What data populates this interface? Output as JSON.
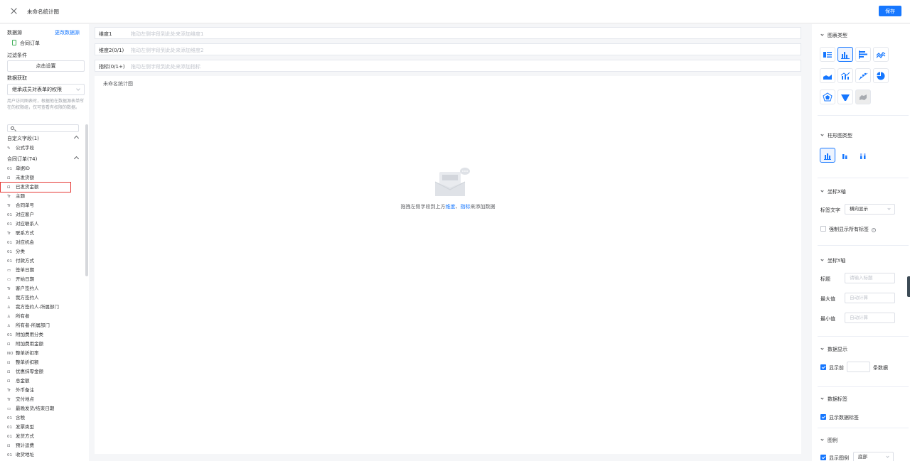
{
  "header": {
    "title": "未命名统计图",
    "save_label": "保存"
  },
  "left": {
    "datasource_label": "数据源",
    "change_link": "更改数据源",
    "datasource_name": "合同订单",
    "filter_label": "过滤条件",
    "filter_button": "点击设置",
    "fetch_label": "数据获取",
    "fetch_select": "继承成员对表单的权限",
    "fetch_hint": "用户访问图表时，根据他在数据源表单所在的权限组，仅可查看有权限的数据。",
    "custom_group": "自定义字段(1)",
    "formula_field": "公式字段",
    "orders_group": "合同订单(74)",
    "fields": [
      {
        "t": "01",
        "label": "单据ID"
      },
      {
        "t": "#",
        "label": "未发货额"
      },
      {
        "t": "#",
        "label": "已发货金额"
      },
      {
        "t": "Tr",
        "label": "主题"
      },
      {
        "t": "Tr",
        "label": "合同单号"
      },
      {
        "t": "01",
        "label": "对应客户"
      },
      {
        "t": "01",
        "label": "对应联系人"
      },
      {
        "t": "Tr",
        "label": "联系方式"
      },
      {
        "t": "01",
        "label": "对应机会"
      },
      {
        "t": "01",
        "label": "分类"
      },
      {
        "t": "01",
        "label": "付款方式"
      },
      {
        "t": "cal",
        "label": "签单日期"
      },
      {
        "t": "cal",
        "label": "开始日期"
      },
      {
        "t": "Tr",
        "label": "客户签约人"
      },
      {
        "t": "usr",
        "label": "我方签约人"
      },
      {
        "t": "usr",
        "label": "我方签约人-所属部门"
      },
      {
        "t": "usr",
        "label": "所有者"
      },
      {
        "t": "usr",
        "label": "所有者-所属部门"
      },
      {
        "t": "01",
        "label": "附加费用分类"
      },
      {
        "t": "#",
        "label": "附加费用金额"
      },
      {
        "t": "NO",
        "label": "整单折扣率"
      },
      {
        "t": "#",
        "label": "整单折扣额"
      },
      {
        "t": "#",
        "label": "优惠抹零金额"
      },
      {
        "t": "#",
        "label": "总金额"
      },
      {
        "t": "Tr",
        "label": "外币备注"
      },
      {
        "t": "Tr",
        "label": "交付地点"
      },
      {
        "t": "cal",
        "label": "最晚发货/结束日期"
      },
      {
        "t": "01",
        "label": "含税"
      },
      {
        "t": "01",
        "label": "发票类型"
      },
      {
        "t": "01",
        "label": "发货方式"
      },
      {
        "t": "#",
        "label": "预计运费"
      },
      {
        "t": "01",
        "label": "收货地址"
      }
    ]
  },
  "center": {
    "rows": [
      {
        "name": "维度1",
        "placeholder": "拖动左侧字段到此处来添加维度1"
      },
      {
        "name": "维度2(0/1)",
        "placeholder": "拖动左侧字段到此处来添加维度2"
      },
      {
        "name": "指标(0/1+)",
        "placeholder": "拖动左侧字段到此处来添加指标"
      }
    ],
    "chart_title": "未命名统计图",
    "empty_before": "拖拽左侧字段到上方",
    "empty_dim": "维度",
    "empty_sep": "、",
    "empty_metric": "指标",
    "empty_after": "来添加数据"
  },
  "right": {
    "chart_type": "图表类型",
    "bar_type": "柱形图类型",
    "x_axis": "坐标X轴",
    "label_text": "标签文字",
    "label_text_value": "横向显示",
    "force_labels": "强制显示所有标签",
    "y_axis": "坐标Y轴",
    "y_title": "标题",
    "y_title_ph": "请输入标题",
    "y_max": "最大值",
    "y_max_ph": "自动计算",
    "y_min": "最小值",
    "y_min_ph": "自动计算",
    "data_display": "数据显示",
    "show_top": "显示前",
    "rows_unit": "条数据",
    "data_labels": "数据标签",
    "show_data_labels": "显示数据标签",
    "legend": "图例",
    "show_legend": "显示图例",
    "legend_pos": "底部"
  },
  "colors": {
    "accent": "#1677ff",
    "highlight_box": "#e53935"
  }
}
